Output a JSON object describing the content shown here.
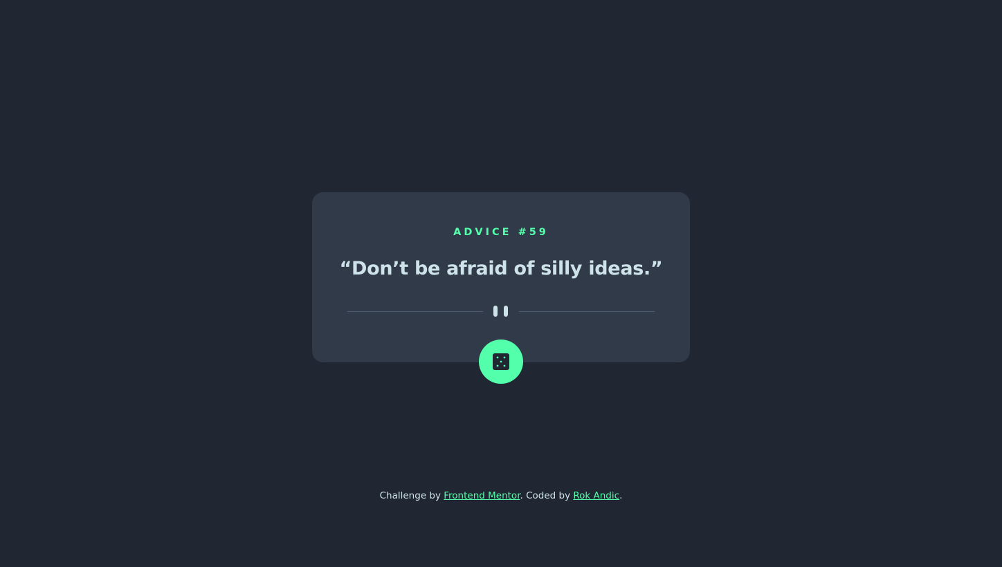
{
  "advice": {
    "id_label": "ADVICE #59",
    "text": "“Don’t be afraid of silly ideas.”"
  },
  "divider": {
    "icon": "pause-icon"
  },
  "dice_button": {
    "icon": "dice-icon"
  },
  "attribution": {
    "prefix": "Challenge by ",
    "link1": "Frontend Mentor",
    "middle": ". Coded by ",
    "link2": "Rok Andic",
    "suffix": "."
  },
  "colors": {
    "background": "#202632",
    "card": "#313a48",
    "accent": "#53ffaa",
    "text": "#cee3e9",
    "divider": "#4f5d74"
  }
}
